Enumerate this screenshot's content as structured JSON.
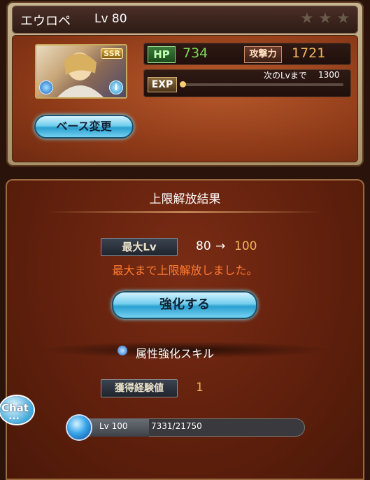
{
  "character": {
    "name_label": "エウロペ",
    "level_label": "Lv 80",
    "rarity": "SSR",
    "stars": 3
  },
  "stats": {
    "hp_label": "HP",
    "hp_value": "734",
    "atk_label": "攻撃力",
    "atk_value": "1721",
    "exp_label": "EXP",
    "next_lv_label": "次のLvまで",
    "next_lv_value": "1300"
  },
  "buttons": {
    "base_change": "ベース変更",
    "enhance": "強化する"
  },
  "result": {
    "title": "上限解放結果",
    "max_lv_label": "最大Lv",
    "lv_from": "80",
    "arrow": "→",
    "lv_to": "100",
    "message": "最大まで上限解放しました。"
  },
  "skill": {
    "label": "属性強化スキル",
    "exp_gained_label": "獲得経験値",
    "exp_gained_value": "1",
    "level": "Lv 100",
    "progress_text": "7331/21750",
    "progress_fraction": 0.337
  },
  "chat": {
    "label": "Chat"
  },
  "colors": {
    "hp_green": "#7fd85a",
    "atk_orange": "#f2b657",
    "message_orange": "#ff7a30",
    "lv_to_orange": "#f2b657"
  }
}
